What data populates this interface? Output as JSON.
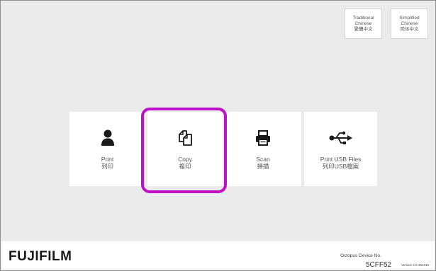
{
  "language_buttons": [
    {
      "line1": "Traditional",
      "line2": "Chinese",
      "line3": "繁體中文"
    },
    {
      "line1": "Simplified",
      "line2": "Chinese",
      "line3": "简体中文"
    }
  ],
  "tiles": [
    {
      "label_en": "Print",
      "label_zh": "列印",
      "icon": "person-icon"
    },
    {
      "label_en": "Copy",
      "label_zh": "複印",
      "icon": "copy-icon"
    },
    {
      "label_en": "Scan",
      "label_zh": "掃描",
      "icon": "printer-icon"
    },
    {
      "label_en": "Print USB Files",
      "label_zh": "列印USB檔案",
      "icon": "usb-icon"
    }
  ],
  "footer": {
    "brand": "FUJIFILM",
    "device_label": "Octopus Device No.",
    "device_no": "5CFF52",
    "version": "Version 4.0-251010"
  },
  "colors": {
    "highlight": "#bd12c9",
    "background": "#ebebeb",
    "tile": "#ffffff"
  }
}
